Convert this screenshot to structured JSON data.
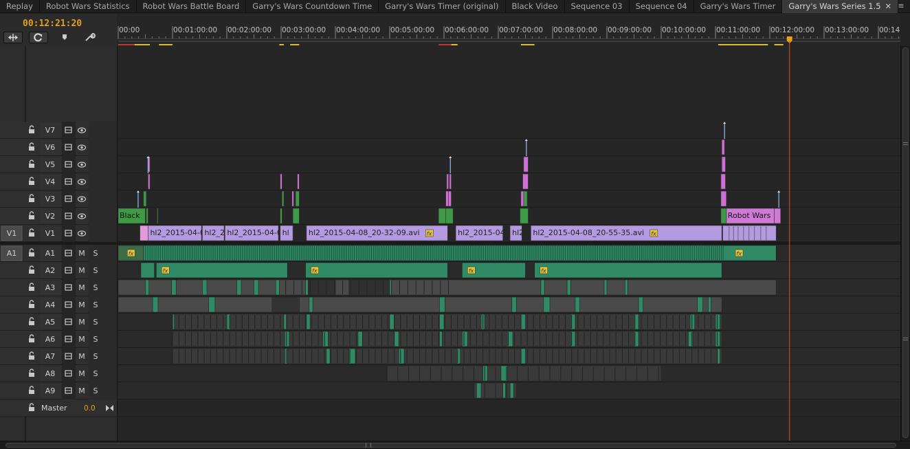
{
  "tabs": [
    {
      "label": "Replay",
      "active": false
    },
    {
      "label": "Robot Wars Statistics",
      "active": false
    },
    {
      "label": "Robot Wars Battle Board",
      "active": false
    },
    {
      "label": "Garry's Wars Countdown Time",
      "active": false
    },
    {
      "label": "Garry's Wars Timer (original)",
      "active": false
    },
    {
      "label": "Black Video",
      "active": false
    },
    {
      "label": "Sequence 03",
      "active": false
    },
    {
      "label": "Sequence 04",
      "active": false
    },
    {
      "label": "Garry's Wars Timer",
      "active": false
    },
    {
      "label": "Garry's Wars Series 1.5",
      "active": true,
      "closable": true
    }
  ],
  "panel_menu_icon": "panel-menu-icon",
  "timecode": "00:12:21:20",
  "tools": [
    {
      "icon": "snap-icon"
    },
    {
      "icon": "linked-selection-icon"
    },
    {
      "icon": "add-marker-icon"
    },
    {
      "icon": "settings-wrench-icon"
    }
  ],
  "ruler": {
    "labels": [
      "00:00",
      "00:01:00:00",
      "00:02:00:00",
      "00:03:00:00",
      "00:04:00:00",
      "00:05:00:00",
      "00:06:00:00",
      "00:07:00:00",
      "00:08:00:00",
      "00:09:00:00",
      "00:10:00:00",
      "00:11:00:00",
      "00:12:00:00",
      "00:13:00:00",
      "00:14:00:00"
    ],
    "seconds_per_major": 60,
    "sequence_end_seconds": 870,
    "playhead_seconds": 741.8
  },
  "colors": {
    "playhead": "#e05020",
    "video_clip": "#b49ae0",
    "video_clip_pink": "#cf7ad6",
    "green_clip": "#3e9a45",
    "audio_clip": "#2f8a65",
    "timecode": "#e3a01e",
    "fx_badge": "#e5c43a"
  },
  "video_tracks": [
    {
      "name": "V7",
      "source": ""
    },
    {
      "name": "V6",
      "source": ""
    },
    {
      "name": "V5",
      "source": ""
    },
    {
      "name": "V4",
      "source": ""
    },
    {
      "name": "V3",
      "source": ""
    },
    {
      "name": "V2",
      "source": ""
    },
    {
      "name": "V1",
      "source": "V1"
    }
  ],
  "audio_tracks": [
    {
      "name": "A1",
      "source": "A1"
    },
    {
      "name": "A2",
      "source": ""
    },
    {
      "name": "A3",
      "source": ""
    },
    {
      "name": "A4",
      "source": ""
    },
    {
      "name": "A5",
      "source": ""
    },
    {
      "name": "A6",
      "source": ""
    },
    {
      "name": "A7",
      "source": ""
    },
    {
      "name": "A8",
      "source": ""
    },
    {
      "name": "A9",
      "source": ""
    }
  ],
  "track_buttons": {
    "mute": "M",
    "solo": "S"
  },
  "master": {
    "name": "Master",
    "volume": "0.0"
  },
  "clips": {
    "v2": [
      {
        "name": "Black",
        "start": 0,
        "end": 30,
        "color": "green"
      },
      {
        "name": "Robot Wars",
        "start": 672,
        "end": 725,
        "color": "pink"
      }
    ],
    "v1": [
      {
        "name": "hl2_2015-04-0",
        "start": 33,
        "end": 92
      },
      {
        "name": "hl2_2",
        "start": 93,
        "end": 117
      },
      {
        "name": "hl2_2015-04-0",
        "start": 118,
        "end": 177
      },
      {
        "name": "hl",
        "start": 179,
        "end": 193
      },
      {
        "name": "hl2_2015-04-08_20-32-09.avi",
        "start": 208,
        "end": 364,
        "fx": true
      },
      {
        "name": "hl2_2015-04",
        "start": 373,
        "end": 425
      },
      {
        "name": "hl2",
        "start": 433,
        "end": 446
      },
      {
        "name": "hl2_2015-04-08_20-55-35.avi",
        "start": 456,
        "end": 667,
        "fx": true
      },
      {
        "name": "",
        "start": 668,
        "end": 727
      }
    ],
    "a1_fx": [
      {
        "start": 7
      },
      {
        "start": 679
      }
    ],
    "a2_fx": [
      {
        "start": 42,
        "end": 187
      },
      {
        "start": 207,
        "end": 364
      },
      {
        "start": 380,
        "end": 450
      },
      {
        "start": 460,
        "end": 667
      }
    ]
  }
}
